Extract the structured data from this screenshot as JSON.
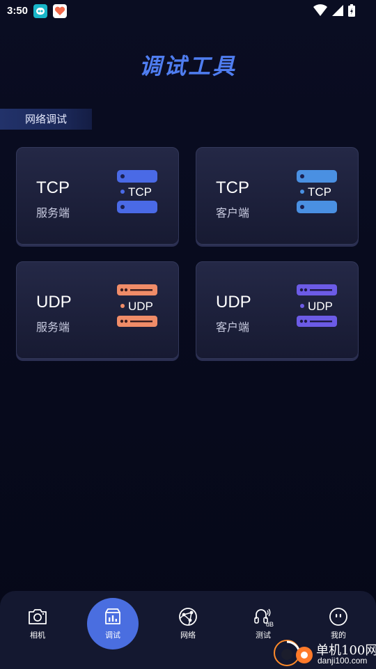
{
  "status_bar": {
    "time": "3:50"
  },
  "header": {
    "title": "调试工具"
  },
  "section": {
    "label": "网络调试"
  },
  "cards": [
    {
      "title": "TCP",
      "subtitle": "服务端",
      "icon_text": "TCP",
      "color": "#4a6ae6",
      "icon": "tcp-server-icon"
    },
    {
      "title": "TCP",
      "subtitle": "客户端",
      "icon_text": "TCP",
      "color": "#4a90e2",
      "icon": "tcp-client-icon"
    },
    {
      "title": "UDP",
      "subtitle": "服务端",
      "icon_text": "UDP",
      "color": "#f08c68",
      "icon": "udp-server-icon"
    },
    {
      "title": "UDP",
      "subtitle": "客户端",
      "icon_text": "UDP",
      "color": "#6c5be6",
      "icon": "udp-client-icon"
    }
  ],
  "bottom_nav": {
    "items": [
      {
        "label": "相机",
        "icon": "camera-icon"
      },
      {
        "label": "调试",
        "icon": "debug-icon",
        "active": true
      },
      {
        "label": "网络",
        "icon": "network-icon"
      },
      {
        "label": "测试",
        "icon": "sound-test-icon"
      },
      {
        "label": "我的",
        "icon": "profile-icon"
      }
    ]
  },
  "watermark": {
    "name": "单机100网",
    "url": "danji100.com"
  }
}
